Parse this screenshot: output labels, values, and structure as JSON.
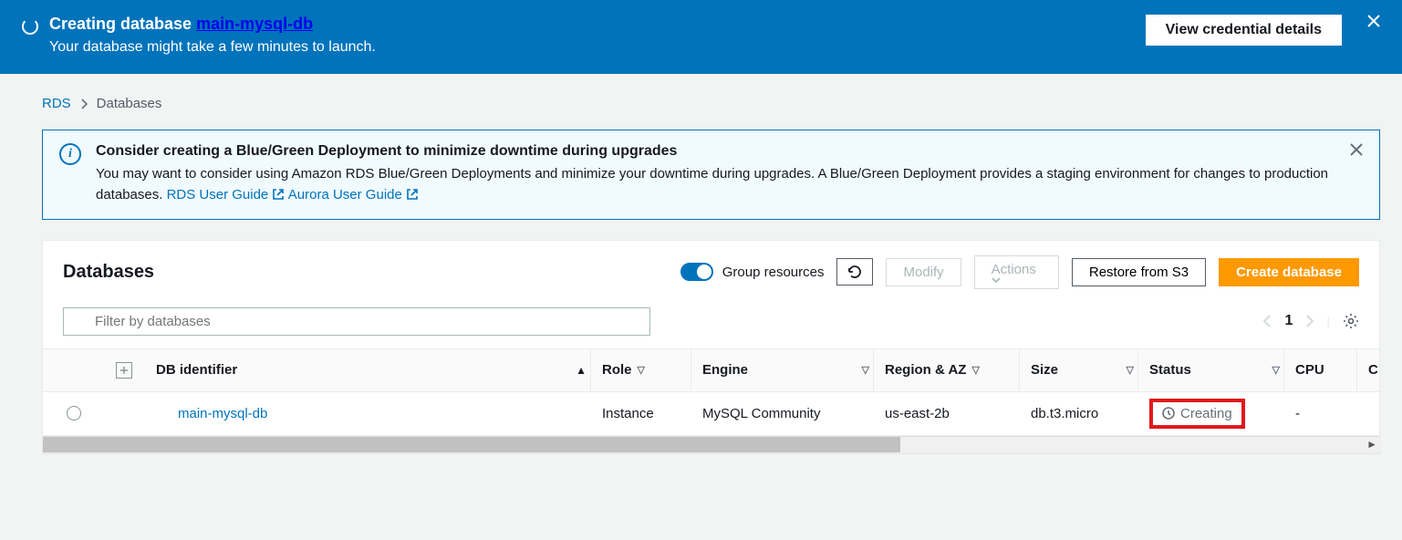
{
  "banner": {
    "title_prefix": "Creating database ",
    "db_name": "main-mysql-db",
    "subtitle": "Your database might take a few minutes to launch.",
    "view_credentials_label": "View credential details"
  },
  "breadcrumb": {
    "root": "RDS",
    "current": "Databases"
  },
  "info_alert": {
    "title": "Consider creating a Blue/Green Deployment to minimize downtime during upgrades",
    "body": "You may want to consider using Amazon RDS Blue/Green Deployments and minimize your downtime during upgrades. A Blue/Green Deployment provides a staging environment for changes to production databases. ",
    "link1": "RDS User Guide",
    "link2": "Aurora User Guide"
  },
  "panel": {
    "title": "Databases",
    "group_resources_label": "Group resources",
    "modify_label": "Modify",
    "actions_label": "Actions",
    "restore_label": "Restore from S3",
    "create_label": "Create database",
    "filter_placeholder": "Filter by databases",
    "page_number": "1"
  },
  "table": {
    "headers": {
      "db_identifier": "DB identifier",
      "role": "Role",
      "engine": "Engine",
      "region_az": "Region & AZ",
      "size": "Size",
      "status": "Status",
      "cpu": "CPU",
      "cx": "C"
    },
    "row": {
      "db_identifier": "main-mysql-db",
      "role": "Instance",
      "engine": "MySQL Community",
      "region_az": "us-east-2b",
      "size": "db.t3.micro",
      "status": "Creating",
      "cpu": "-"
    }
  }
}
